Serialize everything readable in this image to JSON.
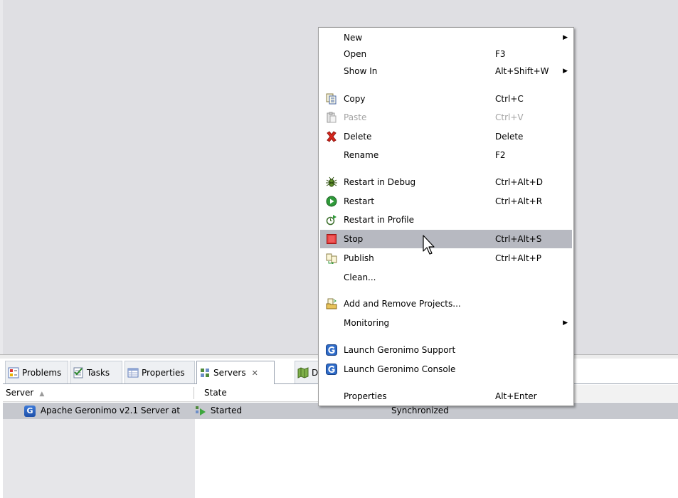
{
  "views": {
    "tabs": [
      {
        "label": "Problems",
        "active": false
      },
      {
        "label": "Tasks",
        "active": false
      },
      {
        "label": "Properties",
        "active": false
      },
      {
        "label": "Servers",
        "active": true,
        "close": "✕"
      },
      {
        "label": "D",
        "active": false
      }
    ]
  },
  "servers_table": {
    "columns": [
      "Server",
      "State"
    ],
    "sort_indicator": "▲",
    "rows": [
      {
        "server": "Apache Geronimo v2.1 Server at",
        "state": "Started",
        "status": "Synchronized",
        "selected": true
      }
    ]
  },
  "context_menu": {
    "groups": [
      [
        {
          "label": "New",
          "accel": "",
          "submenu": true,
          "icon": "none"
        },
        {
          "label": "Open",
          "accel": "F3",
          "submenu": false,
          "icon": "none"
        },
        {
          "label": "Show In",
          "accel": "Alt+Shift+W",
          "submenu": true,
          "icon": "none"
        }
      ],
      [
        {
          "label": "Copy",
          "accel": "Ctrl+C",
          "icon": "copy-icon"
        },
        {
          "label": "Paste",
          "accel": "Ctrl+V",
          "icon": "paste-icon",
          "disabled": true
        },
        {
          "label": "Delete",
          "accel": "Delete",
          "icon": "delete-icon"
        },
        {
          "label": "Rename",
          "accel": "F2",
          "icon": "none"
        }
      ],
      [
        {
          "label": "Restart in Debug",
          "accel": "Ctrl+Alt+D",
          "icon": "debug-icon"
        },
        {
          "label": "Restart",
          "accel": "Ctrl+Alt+R",
          "icon": "restart-icon"
        },
        {
          "label": "Restart in Profile",
          "accel": "",
          "icon": "profile-icon"
        },
        {
          "label": "Stop",
          "accel": "Ctrl+Alt+S",
          "icon": "stop-icon",
          "highlighted": true
        },
        {
          "label": "Publish",
          "accel": "Ctrl+Alt+P",
          "icon": "publish-icon"
        },
        {
          "label": "Clean...",
          "accel": "",
          "icon": "none"
        }
      ],
      [
        {
          "label": "Add and Remove Projects...",
          "accel": "",
          "icon": "add-remove-projects-icon"
        },
        {
          "label": "Monitoring",
          "accel": "",
          "submenu": true,
          "icon": "none"
        }
      ],
      [
        {
          "label": "Launch Geronimo Support",
          "accel": "",
          "icon": "geronimo-icon"
        },
        {
          "label": "Launch Geronimo Console",
          "accel": "",
          "icon": "geronimo-icon"
        }
      ],
      [
        {
          "label": "Properties",
          "accel": "Alt+Enter",
          "icon": "none"
        }
      ]
    ],
    "submenu_arrow": "▶"
  },
  "colors": {
    "editor_bg": "#dfdfe3",
    "menu_highlight": "#b7b9c1",
    "selected_row": "#c6c8ce",
    "stop_red": "#e23b3b",
    "delete_red": "#d8261c",
    "restart_green": "#2f9a3a"
  }
}
